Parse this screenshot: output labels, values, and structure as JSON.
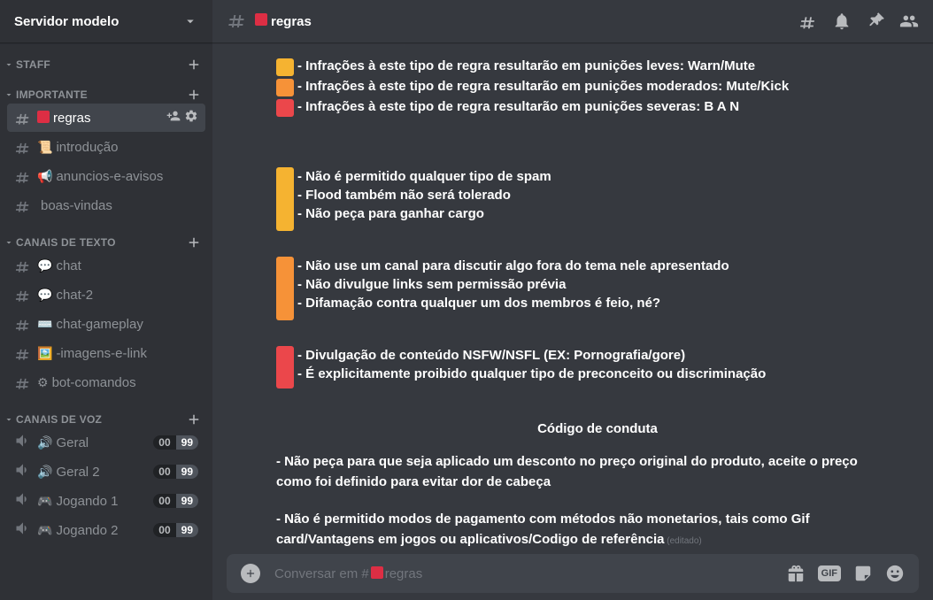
{
  "server": {
    "name": "Servidor modelo"
  },
  "categories": [
    {
      "name": "STAFF",
      "channels": []
    },
    {
      "name": "IMPORTANTE",
      "channels": [
        {
          "emoji_kind": "redsquare",
          "name": "regras",
          "selected": true
        },
        {
          "emoji": "📜",
          "name": "introdução"
        },
        {
          "emoji": "📢",
          "name": "anuncios-e-avisos"
        },
        {
          "emoji": "",
          "name": "boas-vindas"
        }
      ]
    },
    {
      "name": "CANAIS DE TEXTO",
      "channels": [
        {
          "emoji": "💬",
          "name": "chat"
        },
        {
          "emoji": "💬",
          "name": "chat-2"
        },
        {
          "emoji": "⌨️",
          "name": "chat-gameplay"
        },
        {
          "emoji": "🖼️",
          "name": "-imagens-e-link"
        },
        {
          "emoji": "⚙",
          "name": "bot-comandos"
        }
      ]
    },
    {
      "name": "CANAIS DE VOZ",
      "voice": true,
      "channels": [
        {
          "emoji": "🔊",
          "name": "Geral",
          "b1": "00",
          "b2": "99"
        },
        {
          "emoji": "🔊",
          "name": "Geral 2",
          "b1": "00",
          "b2": "99"
        },
        {
          "emoji": "🎮",
          "name": "Jogando 1",
          "b1": "00",
          "b2": "99"
        },
        {
          "emoji": "🎮",
          "name": "Jogando 2",
          "b1": "00",
          "b2": "99"
        }
      ]
    }
  ],
  "topbar": {
    "emoji_kind": "redsquare",
    "channel": "regras"
  },
  "colors": {
    "yellow": "#f5b331",
    "orange": "#f69238",
    "red": "#eb474b"
  },
  "legend": [
    {
      "color": "yellow",
      "text": "- Infrações à este tipo de regra resultarão em punições leves: Warn/Mute"
    },
    {
      "color": "orange",
      "text": "- Infrações à este tipo de regra resultarão em punições moderados: Mute/Kick"
    },
    {
      "color": "red",
      "text": "- Infrações à este tipo de regra resultarão em punições severas: B A N"
    }
  ],
  "rule_groups": [
    {
      "color": "yellow",
      "lines": [
        "- Não é permitido qualquer tipo de spam",
        "- Flood também não será tolerado",
        "- Não peça para ganhar cargo"
      ]
    },
    {
      "color": "orange",
      "lines": [
        "- Não use um canal para discutir algo fora do tema nele apresentado",
        "- Não divulgue links sem permissão prévia",
        "- Difamação contra qualquer um dos membros é feio, né?"
      ]
    },
    {
      "color": "red",
      "lines": [
        "- Divulgação de conteúdo NSFW/NSFL (EX: Pornografia/gore)",
        "- É explicitamente proibido qualquer tipo de preconceito ou discriminação"
      ]
    }
  ],
  "conduct_title": "Código de conduta",
  "conduct_rules": [
    "- Não peça para que seja aplicado um desconto no preço original do produto, aceite o preço como foi definido para evitar dor de cabeça",
    "- Não é permitido modos de pagamento com métodos não monetarios, tais como Gif card/Vantagens em jogos ou aplicativos/Codigo de referência"
  ],
  "edited_tag": "(editado)",
  "input": {
    "placeholder_prefix": "Conversar em #",
    "gif": "GIF"
  }
}
